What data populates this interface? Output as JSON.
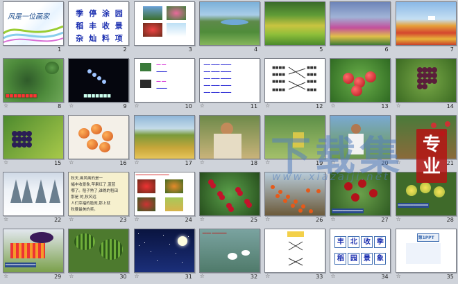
{
  "slides": [
    {
      "num": "1",
      "star": "",
      "caption": "风是一位画家",
      "kind": "title"
    },
    {
      "num": "2",
      "star": "",
      "kind": "pinyin",
      "lines": [
        "季 停 涂 园",
        "稻 丰 收 景",
        "杂 灿 料 项"
      ]
    },
    {
      "num": "3",
      "star": "",
      "kind": "four"
    },
    {
      "num": "4",
      "star": "",
      "kind": "landscape"
    },
    {
      "num": "5",
      "star": "",
      "kind": "field"
    },
    {
      "num": "6",
      "star": "",
      "kind": "flowers"
    },
    {
      "num": "7",
      "star": "",
      "kind": "tulips"
    },
    {
      "num": "8",
      "star": "☆",
      "caption": "",
      "kind": "watermelon"
    },
    {
      "num": "9",
      "star": "☆",
      "caption": "",
      "kind": "night"
    },
    {
      "num": "10",
      "star": "☆",
      "kind": "listgreen"
    },
    {
      "num": "11",
      "star": "☆",
      "kind": "textlist"
    },
    {
      "num": "12",
      "star": "☆",
      "kind": "matching"
    },
    {
      "num": "13",
      "star": "☆",
      "kind": "apples"
    },
    {
      "num": "14",
      "star": "☆",
      "kind": "grapes"
    },
    {
      "num": "15",
      "star": "☆",
      "kind": "grapes2"
    },
    {
      "num": "16",
      "star": "☆",
      "kind": "persimmons"
    },
    {
      "num": "17",
      "star": "☆",
      "kind": "rice"
    },
    {
      "num": "18",
      "star": "☆",
      "kind": "farmer"
    },
    {
      "num": "19",
      "star": "☆",
      "kind": "farmer2"
    },
    {
      "num": "20",
      "star": "☆",
      "kind": "farmer3"
    },
    {
      "num": "21",
      "star": "☆",
      "kind": "orchard"
    },
    {
      "num": "22",
      "star": "☆",
      "kind": "snow"
    },
    {
      "num": "23",
      "star": "☆",
      "kind": "poem",
      "lines": [
        "秋天,画风画的是一",
        "幅丰收景象,苹果红了,蓝蓝",
        "哪了。稻子熟了,谁晚的稻田",
        "那是 的,秋风远",
        "人们幸福的脸庞,那上就",
        "秋要最美的奖。"
      ]
    },
    {
      "num": "24",
      "star": "☆",
      "kind": "collage"
    },
    {
      "num": "25",
      "star": "☆",
      "kind": "berries"
    },
    {
      "num": "26",
      "star": "☆",
      "kind": "persim2"
    },
    {
      "num": "27",
      "star": "☆",
      "kind": "redfruit"
    },
    {
      "num": "28",
      "star": "☆",
      "kind": "yellowfruit"
    },
    {
      "num": "29",
      "star": "☆",
      "kind": "eggplant"
    },
    {
      "num": "30",
      "star": "☆",
      "kind": "melons"
    },
    {
      "num": "31",
      "star": "☆",
      "kind": "moon"
    },
    {
      "num": "32",
      "star": "☆",
      "kind": "lotus"
    },
    {
      "num": "33",
      "star": "☆",
      "kind": "matching2"
    },
    {
      "num": "34",
      "star": "☆",
      "kind": "chars",
      "chars": [
        "丰",
        "北",
        "收",
        "季",
        "稻",
        "园",
        "景",
        "象"
      ]
    },
    {
      "num": "35",
      "star": "☆",
      "kind": "ppt",
      "caption": "第1PPT"
    }
  ],
  "watermark": {
    "main": "下载集",
    "box": [
      "专",
      "业"
    ],
    "url": "www.xiazaiji.net"
  },
  "colors": {
    "background": "#cfd3da",
    "border": "#7b7f88"
  }
}
